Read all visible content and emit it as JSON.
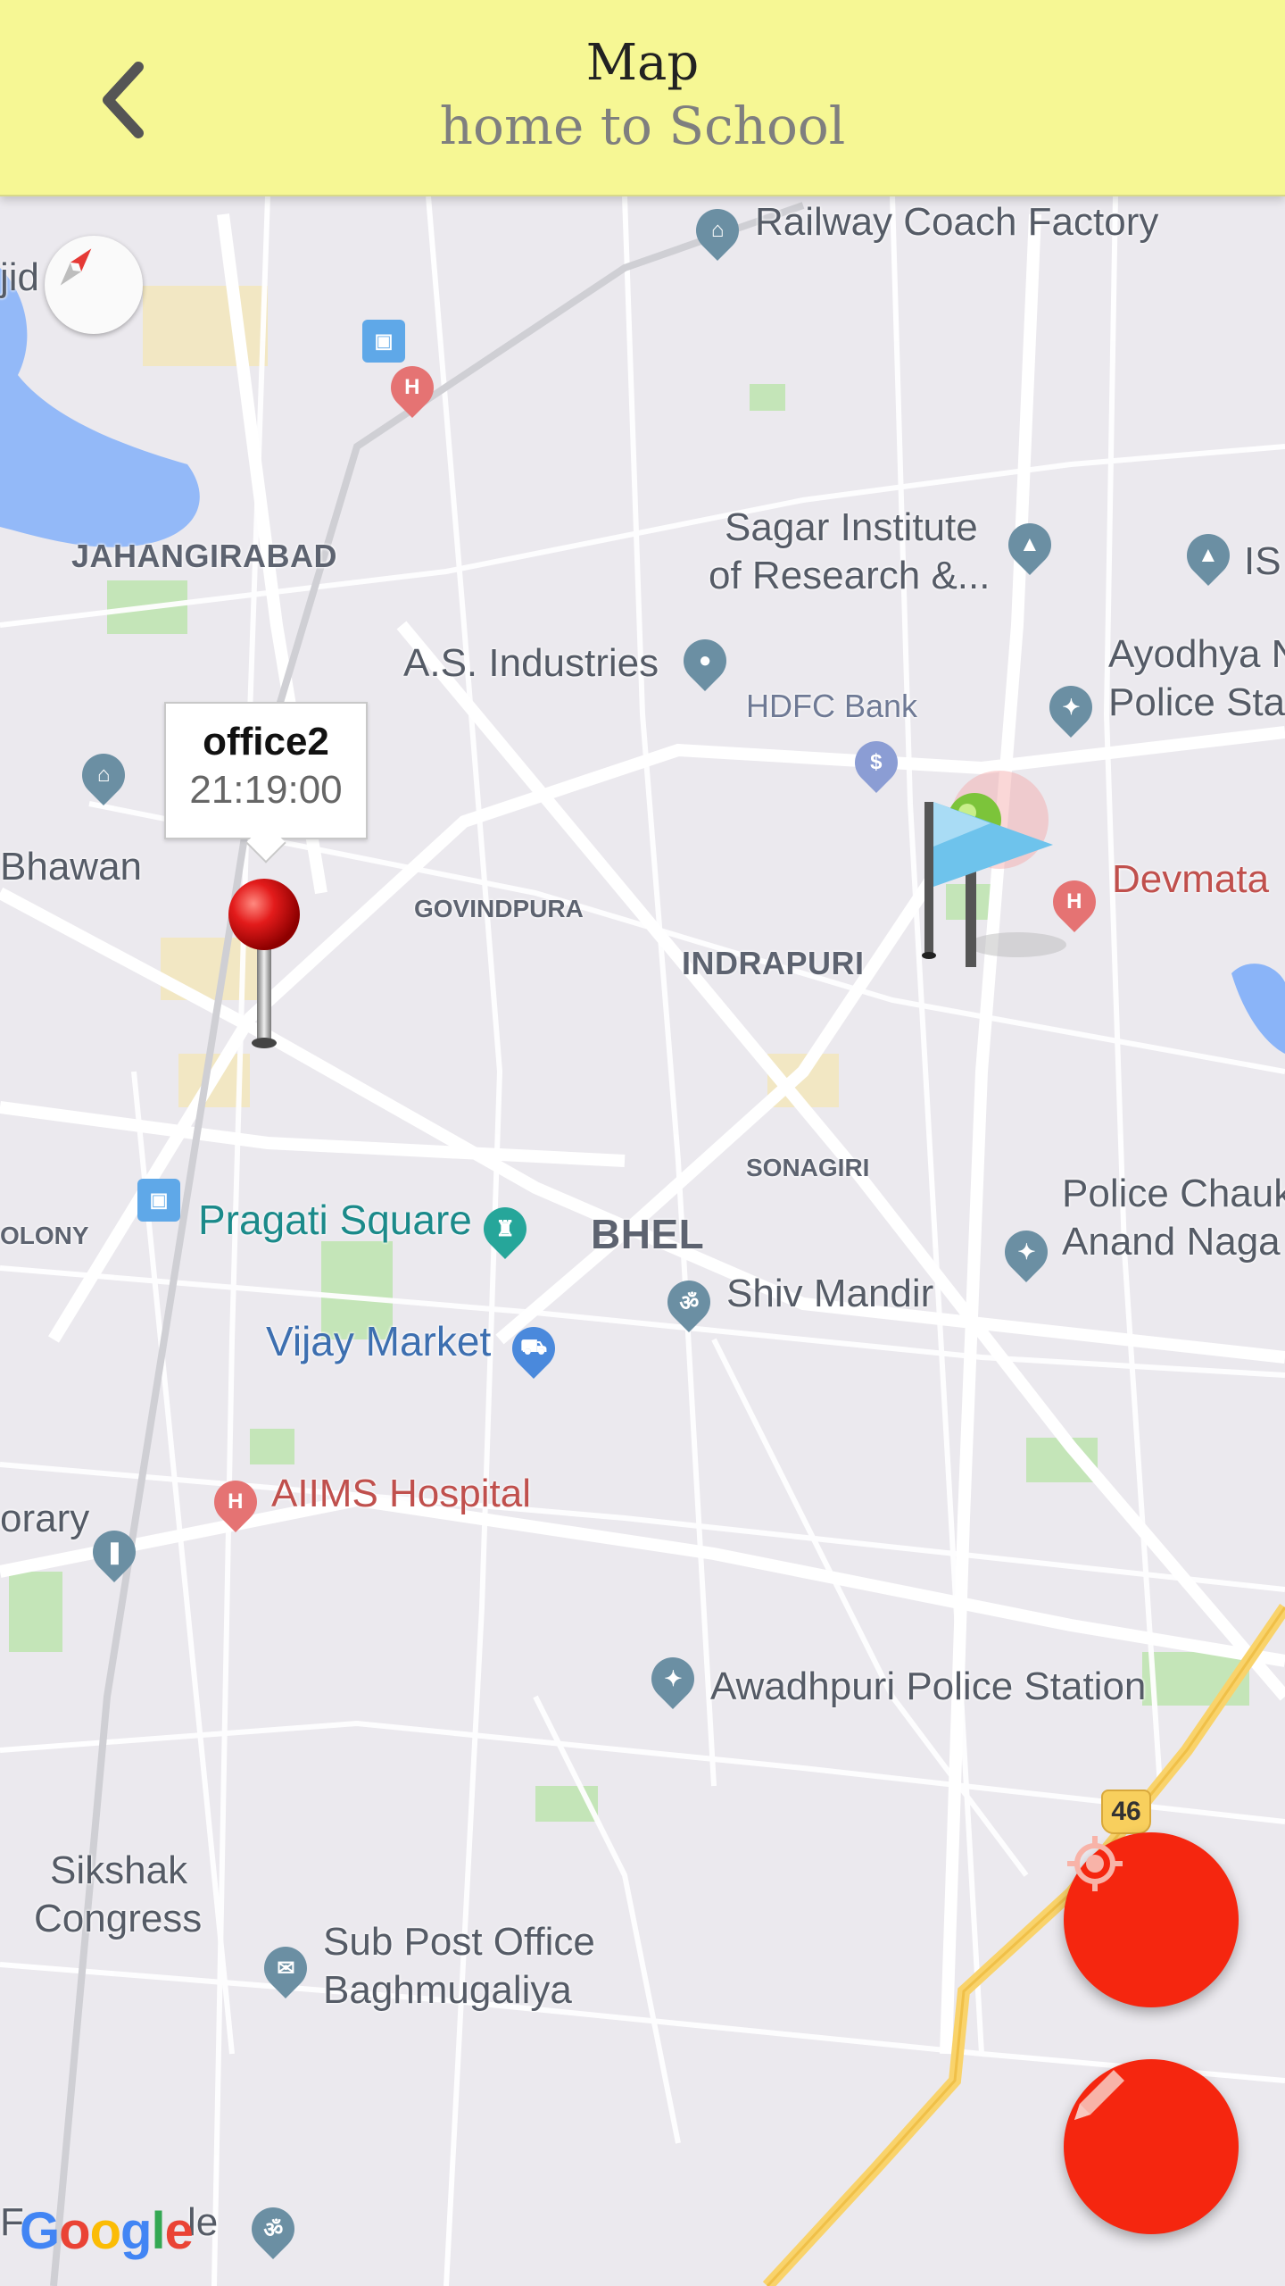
{
  "header": {
    "title": "Map",
    "subtitle": "home to School",
    "background": "#f6f794"
  },
  "map": {
    "labels": {
      "railway_coach_factory": "Railway Coach Factory",
      "sagar_institute_line1": "Sagar Institute",
      "sagar_institute_line2": "of Research &...",
      "is": "IS",
      "jahangirabad": "JAHANGIRABAD",
      "as_industries": "A.S. Industries",
      "hdfc_bank": "HDFC Bank",
      "ayodhya_line1": "Ayodhya N",
      "ayodhya_line2": "Police Sta",
      "bhawan": "Bhawan",
      "govindpura": "GOVINDPURA",
      "indrapuri": "INDRAPURI",
      "devmata": "Devmata",
      "sonagiri": "SONAGIRI",
      "police_chauki_line1": "Police Chauk",
      "police_chauki_line2": "Anand Naga",
      "olony": "OLONY",
      "pragati_square": "Pragati Square",
      "bhel": "BHEL",
      "shiv_mandir": "Shiv Mandir",
      "vijay_market": "Vijay Market",
      "aiims_hospital": "AIIMS Hospital",
      "library": "orary",
      "awadhpuri": "Awadhpuri Police Station",
      "sikshak_line1": "Sikshak",
      "sikshak_line2": "Congress",
      "sub_post_line1": "Sub Post Office",
      "sub_post_line2": "Baghmugaliya",
      "jid": "jid",
      "bottom_left": "F",
      "bottom_le": "le",
      "route_shield": "46",
      "google": "Google"
    },
    "marker": {
      "name": "office2",
      "time": "21:19:00"
    },
    "icons": {
      "compass": "compass-icon",
      "pin": "red-pin-icon",
      "flag": "destination-flag-icon",
      "hospital": "hospital-icon",
      "locate": "my-location-icon",
      "edit": "edit-pencil-icon"
    }
  },
  "colors": {
    "accent": "#f5260f",
    "teal_poi": "#26a69a",
    "hospital": "#e57373",
    "blue_poi": "#4a89dc",
    "road_highway": "#f9d36b"
  }
}
